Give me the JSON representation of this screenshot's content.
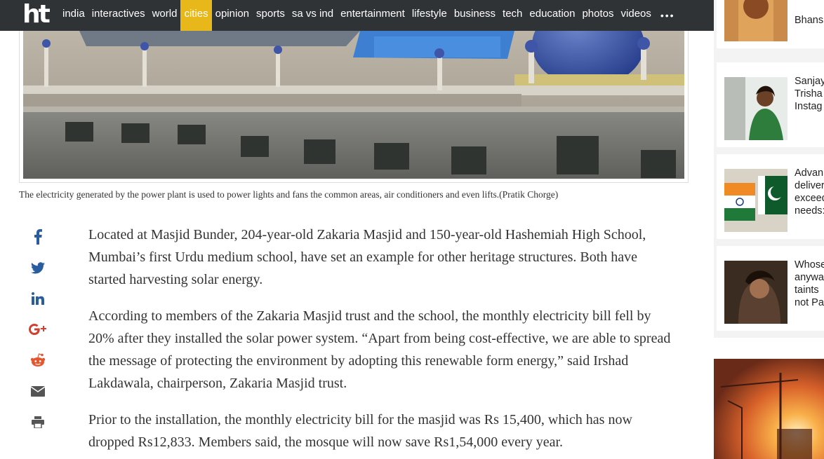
{
  "nav": {
    "logo": "ht",
    "items": [
      "india",
      "interactives",
      "world",
      "cities",
      "opinion",
      "sports",
      "sa vs ind",
      "entertainment",
      "lifestyle",
      "business",
      "tech",
      "education",
      "photos",
      "videos"
    ],
    "active": "cities",
    "more": "•••"
  },
  "hero": {
    "caption": "The electricity generated by the power plant is used to power lights and fans the common areas, air conditioners and even lifts.(Pratik Chorge)"
  },
  "share": [
    "facebook-icon",
    "twitter-icon",
    "linkedin-icon",
    "google-plus-icon",
    "reddit-icon",
    "email-icon",
    "print-icon"
  ],
  "article": {
    "paragraphs": [
      "Located at Masjid Bunder, 204-year-old Zakaria Masjid and 150-year-old Hashemiah High School, Mumbai’s first Urdu medium school, have set an example for other heritage structures. Both have started harvesting solar energy.",
      "According to members of the Zakaria Masjid trust and the school, the monthly electricity bill fell by 20% after they installed the solar power system. “Apart from being cost-effective, we are able to spread the message of protecting the environment by adopting this renewable form energy,” said Irshad Lakdawala, chairperson, Zakaria Masjid trust.",
      "Prior to the installation, the monthly electricity bill for the masjid was Rs 15,400, which has now dropped Rs12,833. Members said, the mosque will now save Rs1,54,000 every year."
    ]
  },
  "sidebar": {
    "items": [
      {
        "lines": [
          "Bhans"
        ]
      },
      {
        "lines": [
          "Sanjay",
          "Trisha",
          "Instag"
        ]
      },
      {
        "lines": [
          "Advan",
          "deliver",
          "exceed",
          "needs:"
        ]
      },
      {
        "lines": [
          "Whose",
          "anywa",
          "taints",
          "not Pa"
        ]
      }
    ]
  },
  "colors": {
    "nav_bg": "#2f3336",
    "active_nav": "#e8b71a",
    "share_icon": "#2a5d9f",
    "google_plus": "#d23f31",
    "reddit": "#e4572e",
    "gray_icon": "#555555"
  }
}
